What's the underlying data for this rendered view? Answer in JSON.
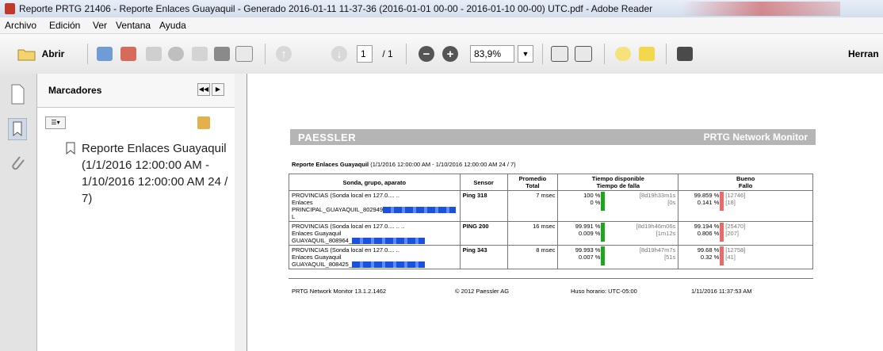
{
  "window": {
    "title": "Reporte PRTG 21406 - Reporte Enlaces Guayaquil - Generado 2016-01-11 11-37-36 (2016-01-01 00-00 - 2016-01-10 00-00) UTC.pdf - Adobe Reader"
  },
  "menu": [
    "Archivo",
    "Edición",
    "Ver",
    "Ventana",
    "Ayuda"
  ],
  "toolbar": {
    "open_label": "Abrir",
    "page_current": "1",
    "page_total": "/ 1",
    "zoom": "83,9%",
    "tools_label": "Herran"
  },
  "bookmarks": {
    "header": "Marcadores",
    "item": "Reporte Enlaces Guayaquil (1/1/2016 12:00:00 AM - 1/10/2016 12:00:00 AM 24 / 7)"
  },
  "report": {
    "brand_left": "PAESSLER",
    "brand_right": "PRTG Network Monitor",
    "title_bold": "Reporte Enlaces Guayaquil",
    "title_rest": " (1/1/2016 12:00:00 AM - 1/10/2016 12:00:00 AM 24 / 7)",
    "headers": {
      "device": "Sonda, grupo, aparato",
      "sensor": "Sensor",
      "avg_1": "Promedio",
      "avg_2": "Total",
      "uptime_1": "Tiempo disponible",
      "uptime_2": "Tiempo de falla",
      "good_1": "Bueno",
      "good_2": "Fallo"
    },
    "rows": [
      {
        "probe": "PROVINCIAS (Sonda local en 127.0.... ..",
        "group": "Enlaces",
        "device": "PRINCIPAL_GUAYAQUIL_802949",
        "device_tail": "L",
        "sensor": "Ping 318",
        "avg": "7 msec",
        "up_pct": "100 %",
        "down_pct": "0 %",
        "up_time": "[8d19h33m1s",
        "down_time": "[0s",
        "good_pct": "99.859 %",
        "fail_pct": "0.141 %",
        "good_count": "[12746]",
        "fail_count": "[18]"
      },
      {
        "probe": "PROVINCIAS (Sonda local en 127.0.... .. ..",
        "group": "Enlaces Guayaquil",
        "device": "GUAYAQUIL_808964_",
        "device_tail": "",
        "sensor": "PING 200",
        "avg": "16 msec",
        "up_pct": "99.991 %",
        "down_pct": "0.009 %",
        "up_time": "[8d19h46m06s",
        "down_time": "[1m12s",
        "good_pct": "99.194 %",
        "fail_pct": "0.806 %",
        "good_count": "[25470]",
        "fail_count": "[207]"
      },
      {
        "probe": "PROVINCIAS (Sonda local en 127.0.... ..",
        "group": "Enlaces Guayaquil",
        "device": "GUAYAQUIL_808425_",
        "device_tail": "",
        "sensor": "Ping 343",
        "avg": "8 msec",
        "up_pct": "99.993 %",
        "down_pct": "0.007 %",
        "up_time": "[8d19h47m7s",
        "down_time": "[51s",
        "good_pct": "99.68 %",
        "fail_pct": "0.32 %",
        "good_count": "[12758]",
        "fail_count": "[41]"
      }
    ],
    "footer": {
      "version": "PRTG Network Monitor 13.1.2.1462",
      "copyright": "© 2012 Paessler AG",
      "timezone": "Huso horario: UTC-05:00",
      "generated": "1/11/2016 11:37:53 AM"
    }
  },
  "colors": {
    "up_bar": "#1fa51f",
    "fail_bar": "#e86a6a",
    "banner": "#b5b5b5",
    "redacted": "#1a52e0"
  }
}
